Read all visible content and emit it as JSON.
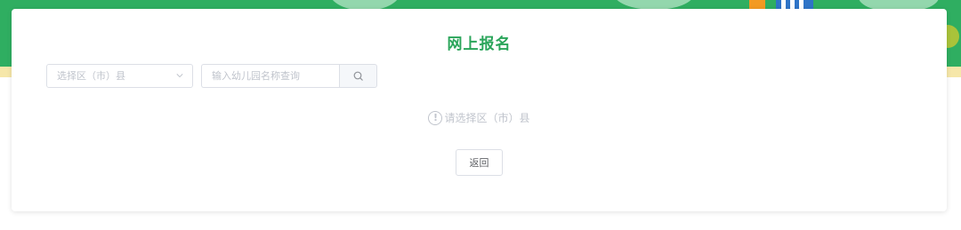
{
  "page": {
    "title": "网上报名"
  },
  "filters": {
    "district_select": {
      "placeholder": "选择区（市）县"
    },
    "kindergarten_search": {
      "placeholder": "输入幼儿园名称查询",
      "value": ""
    }
  },
  "empty_state": {
    "message": "请选择区（市）县",
    "icon": "!"
  },
  "actions": {
    "back_label": "返回"
  },
  "colors": {
    "accent": "#2aa55a",
    "banner": "#2fae61",
    "muted_text": "#c0c4cc",
    "border": "#dcdfe6"
  },
  "icons": {
    "select_arrow": "chevron-down-icon",
    "search": "search-icon",
    "warning": "exclamation-circle-icon"
  }
}
